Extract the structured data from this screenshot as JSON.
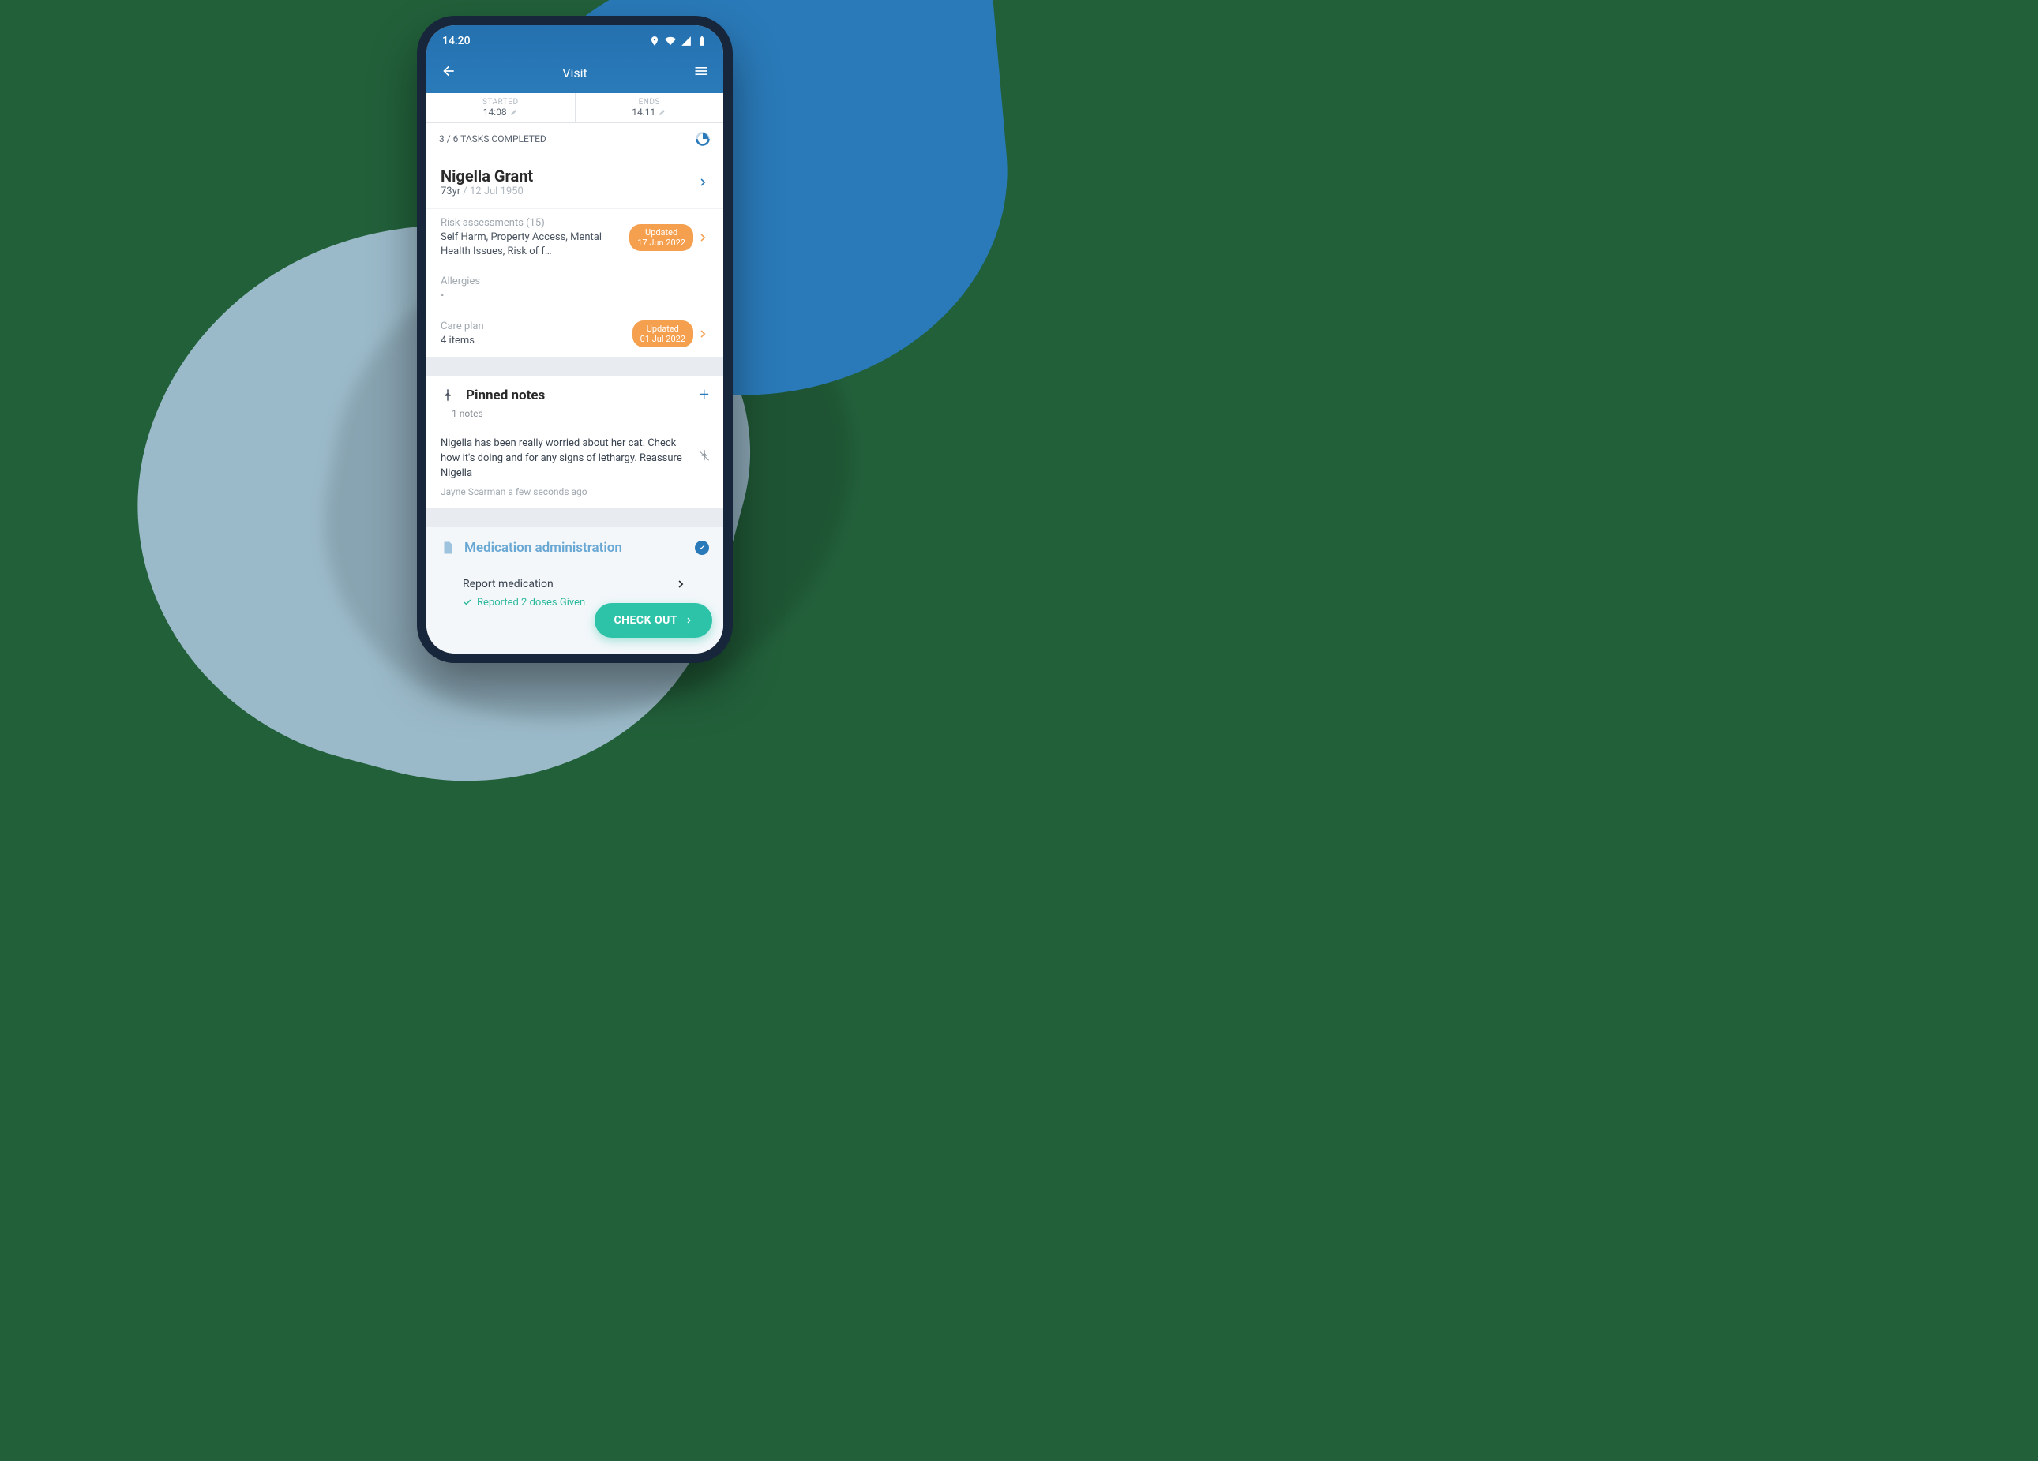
{
  "status_bar": {
    "time": "14:20"
  },
  "nav": {
    "title": "Visit"
  },
  "times": {
    "started_label": "STARTED",
    "started_value": "14:08",
    "ends_label": "ENDS",
    "ends_value": "14:11"
  },
  "tasks": {
    "completed_text": "3 / 6 TASKS COMPLETED"
  },
  "patient": {
    "name": "Nigella Grant",
    "age": "73yr",
    "dob": "/ 12 Jul 1950"
  },
  "risk": {
    "label": "Risk assessments (15)",
    "summary": "Self Harm, Property Access, Mental Health Issues, Risk of f…",
    "badge_line1": "Updated",
    "badge_line2": "17 Jun 2022"
  },
  "allergies": {
    "label": "Allergies",
    "value": "-"
  },
  "careplan": {
    "label": "Care plan",
    "value": "4 items",
    "badge_line1": "Updated",
    "badge_line2": "01 Jul 2022"
  },
  "pinned": {
    "title": "Pinned notes",
    "count": "1 notes",
    "note_body": "Nigella has been really worried about her cat. Check how it's doing and for any signs of lethargy. Reassure Nigella",
    "note_meta": "Jayne Scarman a few seconds ago"
  },
  "medication": {
    "title": "Medication administration",
    "report_label": "Report medication",
    "reported_text": "Reported 2 doses Given"
  },
  "checkout": {
    "label": "CHECK OUT"
  }
}
